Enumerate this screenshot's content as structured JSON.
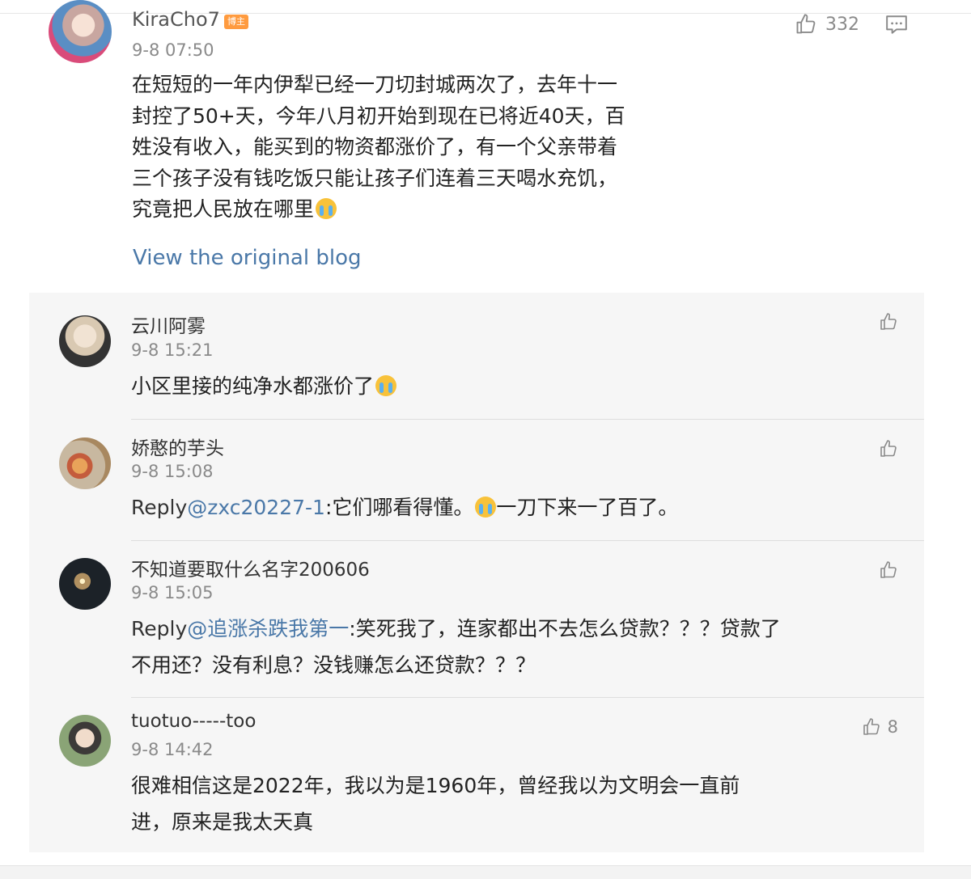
{
  "main_comment": {
    "username": "KiraCho7",
    "badge": "博主",
    "time": "9-8 07:50",
    "likes": "332",
    "text_lines": [
      "在短短的一年内伊犁已经一刀切封城两次了，去年十一",
      "封控了50+天，今年八月初开始到现在已将近40天，百",
      "姓没有收入，能买到的物资都涨价了，有一个父亲带着",
      "三个孩子没有钱吃饭只能让孩子们连着三天喝水充饥，",
      "究竟把人民放在哪里"
    ],
    "view_original": "View the original blog"
  },
  "replies": [
    {
      "username": "云川阿雾",
      "time": "9-8 15:21",
      "likes": "",
      "prefix": "",
      "mention": "",
      "lines": [
        "小区里接的纯净水都涨价了"
      ]
    },
    {
      "username": "娇憨的芋头",
      "time": "9-8 15:08",
      "likes": "",
      "prefix": "Reply",
      "mention": "@zxc20227-1",
      "lines": [
        ":它们哪看得懂。",
        "一刀下来一了百了。"
      ]
    },
    {
      "username": "不知道要取什么名字200606",
      "time": "9-8 15:05",
      "likes": "",
      "prefix": "Reply",
      "mention": "@追涨杀跌我第一",
      "lines": [
        ":笑死我了，连家都出不去怎么贷款？？？贷款了",
        "不用还？没有利息？没钱赚怎么还贷款？？？"
      ]
    },
    {
      "username": "tuotuo-----too",
      "time": "9-8 14:42",
      "likes": "8",
      "prefix": "",
      "mention": "",
      "lines": [
        "很难相信这是2022年，我以为是1960年，曾经我以为文明会一直前",
        "进，原来是我太天真"
      ]
    }
  ],
  "icons": {
    "like": "thumbs-up-icon",
    "comment": "comment-icon",
    "emoji": "crying-face-emoji"
  },
  "colors": {
    "link": "#4a78a8",
    "badge": "#ff9b3f",
    "panel": "#f6f6f6",
    "muted": "#8a8a8a"
  }
}
